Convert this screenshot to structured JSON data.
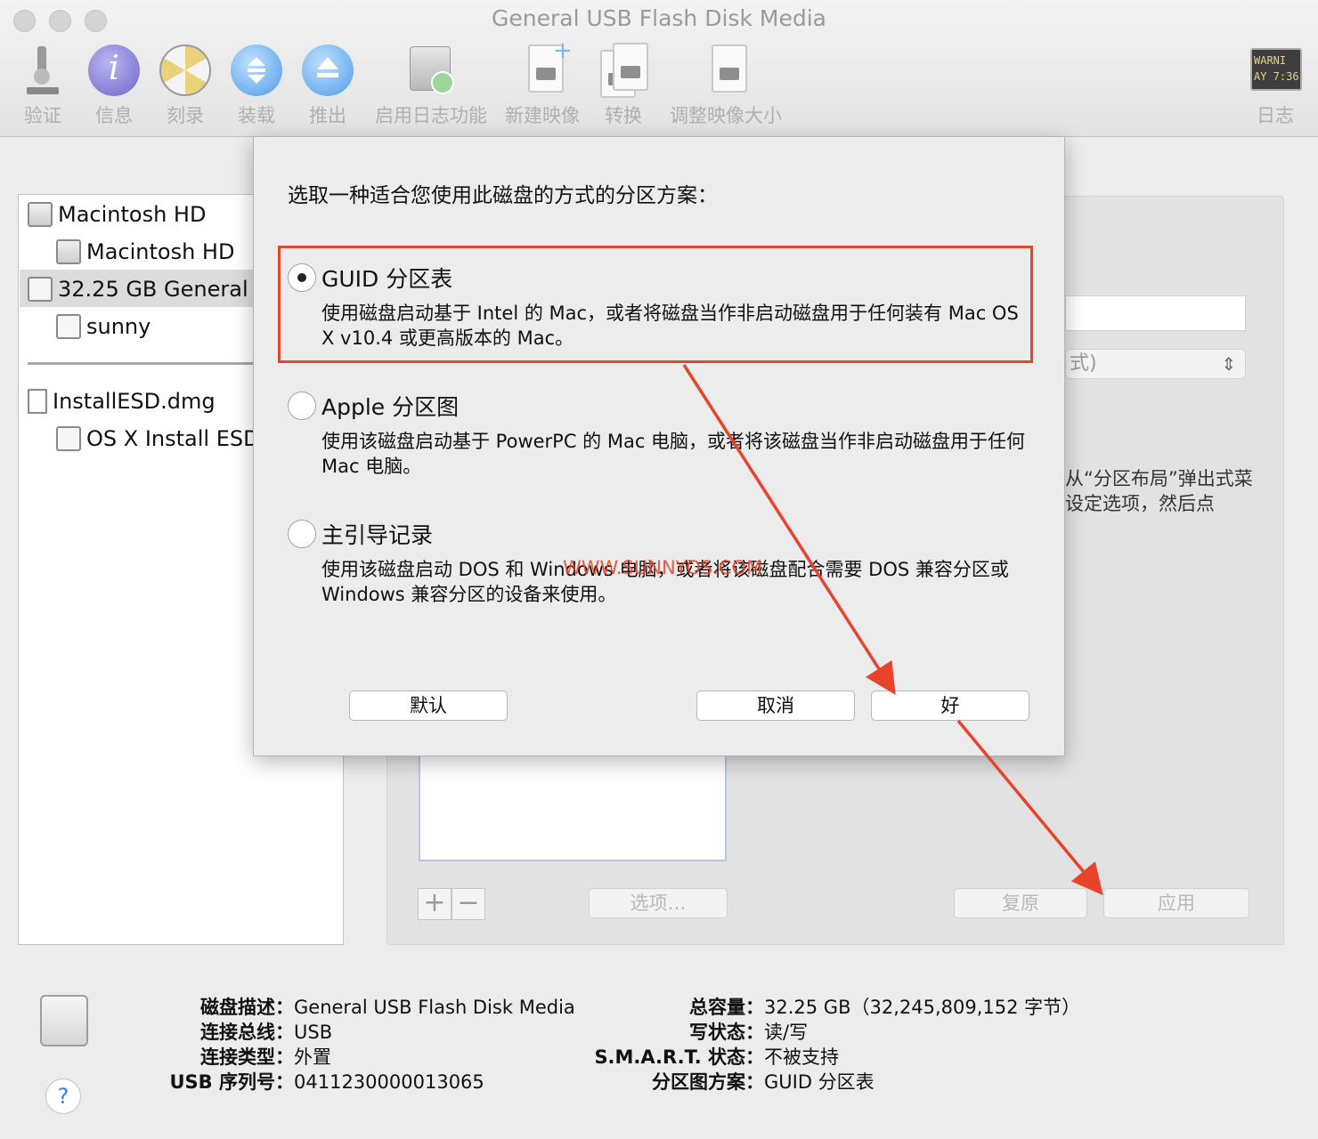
{
  "window": {
    "title": "General USB Flash Disk Media"
  },
  "toolbar": {
    "items": [
      {
        "label": "验证",
        "icon": "microscope-icon"
      },
      {
        "label": "信息",
        "icon": "info-icon"
      },
      {
        "label": "刻录",
        "icon": "burn-icon"
      },
      {
        "label": "装载",
        "icon": "mount-icon"
      },
      {
        "label": "推出",
        "icon": "eject-icon"
      },
      {
        "label": "启用日志功能",
        "icon": "enable-journaling-icon"
      },
      {
        "label": "新建映像",
        "icon": "new-image-icon"
      },
      {
        "label": "转换",
        "icon": "convert-icon"
      },
      {
        "label": "调整映像大小",
        "icon": "resize-image-icon"
      }
    ],
    "log": {
      "label": "日志",
      "icon_text": "WARNI\nAY 7:36"
    }
  },
  "sidebar": {
    "items": [
      {
        "label": "Macintosh HD",
        "icon": "internal-disk-icon"
      },
      {
        "label": "Macintosh HD",
        "icon": "volume-icon"
      },
      {
        "label": "32.25 GB General U",
        "icon": "usb-disk-icon"
      },
      {
        "label": "sunny",
        "icon": "volume-icon"
      },
      {
        "label": "InstallESD.dmg",
        "icon": "dmg-file-icon"
      },
      {
        "label": "OS X Install ESD",
        "icon": "volume-icon"
      }
    ]
  },
  "panel": {
    "format_fragment": "式)",
    "hint_text": "从“分区布局”弹出式菜\n设定选项，然后点",
    "options_button": "选项…",
    "revert_button": "复原",
    "apply_button": "应用",
    "plus": "+",
    "minus": "−"
  },
  "sheet": {
    "title": "选取一种适合您使用此磁盘的方式的分区方案：",
    "options": [
      {
        "label": "GUID 分区表",
        "desc": "使用磁盘启动基于 Intel 的 Mac，或者将磁盘当作非启动磁盘用于任何装有 Mac OS X v10.4 或更高版本的 Mac。",
        "selected": true
      },
      {
        "label": "Apple 分区图",
        "desc": "使用该磁盘启动基于 PowerPC 的 Mac 电脑，或者将该磁盘当作非启动磁盘用于任何 Mac 电脑。",
        "selected": false
      },
      {
        "label": "主引导记录",
        "desc": "使用该磁盘启动 DOS 和 Windows 电脑，或者将该磁盘配合需要 DOS 兼容分区或 Windows 兼容分区的设备来使用。",
        "selected": false
      }
    ],
    "default_button": "默认",
    "cancel_button": "取消",
    "ok_button": "好",
    "watermark": "WWW.SUNNYOS.COM"
  },
  "info": {
    "disk_description_label": "磁盘描述：",
    "disk_description": "General USB Flash Disk Media",
    "bus_label": "连接总线：",
    "bus": "USB",
    "type_label": "连接类型：",
    "type": "外置",
    "serial_label": "USB 序列号：",
    "serial": "0411230000013065",
    "capacity_label": "总容量：",
    "capacity": "32.25 GB（32,245,809,152 字节）",
    "write_label": "写状态：",
    "write": "读/写",
    "smart_label": "S.M.A.R.T. 状态：",
    "smart": "不被支持",
    "scheme_label": "分区图方案：",
    "scheme": "GUID 分区表",
    "help": "?"
  },
  "colors": {
    "annotation": "#e8432b",
    "accent": "#2a7ef0"
  }
}
